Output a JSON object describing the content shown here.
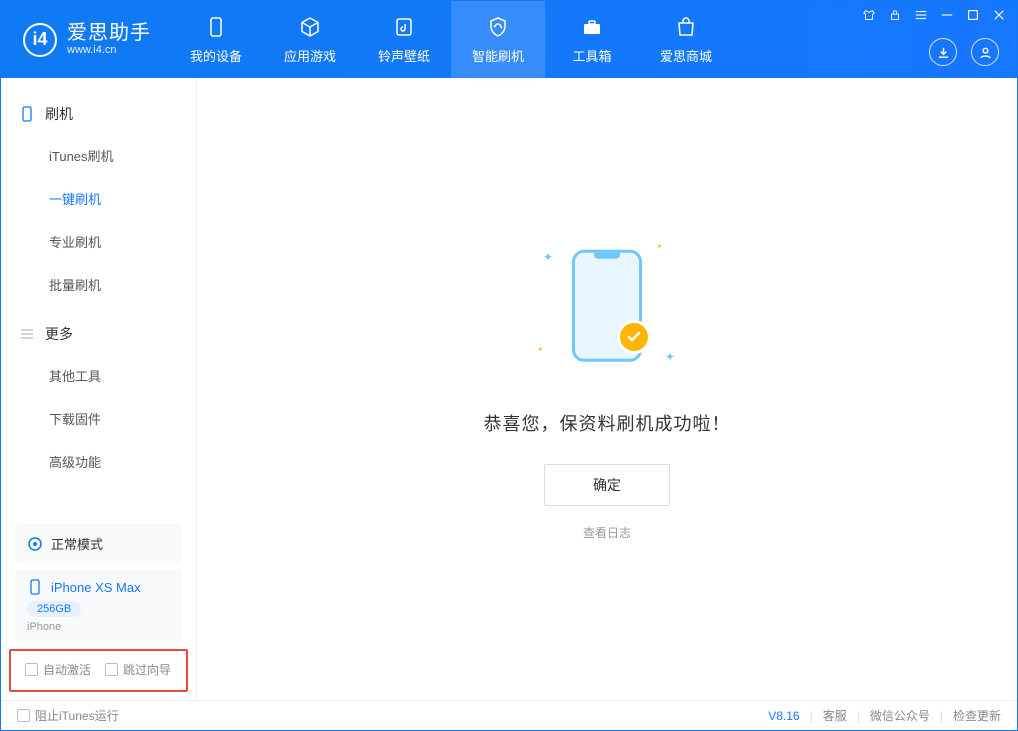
{
  "header": {
    "logo_title": "爱思助手",
    "logo_sub": "www.i4.cn",
    "tabs": [
      {
        "label": "我的设备"
      },
      {
        "label": "应用游戏"
      },
      {
        "label": "铃声壁纸"
      },
      {
        "label": "智能刷机"
      },
      {
        "label": "工具箱"
      },
      {
        "label": "爱思商城"
      }
    ]
  },
  "sidebar": {
    "section1_title": "刷机",
    "items1": [
      {
        "label": "iTunes刷机"
      },
      {
        "label": "一键刷机"
      },
      {
        "label": "专业刷机"
      },
      {
        "label": "批量刷机"
      }
    ],
    "section2_title": "更多",
    "items2": [
      {
        "label": "其他工具"
      },
      {
        "label": "下载固件"
      },
      {
        "label": "高级功能"
      }
    ],
    "mode_label": "正常模式",
    "device_name": "iPhone XS Max",
    "device_storage": "256GB",
    "device_type": "iPhone",
    "checkbox1": "自动激活",
    "checkbox2": "跳过向导"
  },
  "main": {
    "success_text": "恭喜您，保资料刷机成功啦！",
    "ok_button": "确定",
    "log_link": "查看日志"
  },
  "footer": {
    "block_itunes": "阻止iTunes运行",
    "version": "V8.16",
    "link1": "客服",
    "link2": "微信公众号",
    "link3": "检查更新"
  }
}
